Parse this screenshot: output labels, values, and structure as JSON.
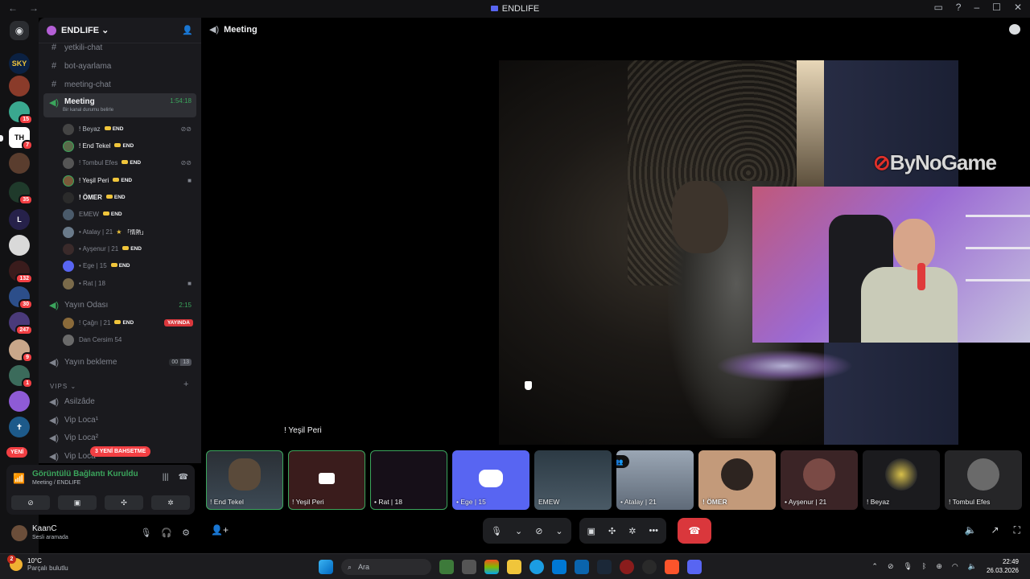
{
  "window": {
    "title": "ENDLIFE"
  },
  "server": {
    "name": "ENDLIFE"
  },
  "channels": {
    "text": [
      {
        "name": "yetkili-chat"
      },
      {
        "name": "bot-ayarlama"
      },
      {
        "name": "meeting-chat"
      }
    ],
    "meeting": {
      "name": "Meeting",
      "timer": "1:54:18",
      "status": "Bir kanal durumu belirle"
    },
    "meeting_users": [
      {
        "name": "! Beyaz",
        "tag": "END",
        "color": "#b5bac1"
      },
      {
        "name": "! End Tekel",
        "tag": "END",
        "color": "#f2f3f5"
      },
      {
        "name": "! Tombul Efes",
        "tag": "END",
        "color": "#80848e"
      },
      {
        "name": "! Yeşil Peri",
        "tag": "END",
        "color": "#f2f3f5"
      },
      {
        "name": "! ÖMER",
        "tag": "END",
        "color": "#f2f3f5"
      },
      {
        "name": "EMEW",
        "tag": "END",
        "color": "#80848e"
      },
      {
        "name": "• Atalay | 21",
        "tag": "「情熱」",
        "color": "#80848e"
      },
      {
        "name": "• Ayşenur | 21",
        "tag": "END",
        "color": "#80848e"
      },
      {
        "name": "• Ege | 15",
        "tag": "END",
        "color": "#80848e"
      },
      {
        "name": "• Rat | 18",
        "tag": "",
        "color": "#80848e"
      }
    ],
    "yayin": {
      "name": "Yayın Odası",
      "timer": "2:15"
    },
    "yayin_users": [
      {
        "name": "! Çağrı | 21",
        "tag": "END",
        "live": "YAYINDA"
      },
      {
        "name": "Dan Cersim 54"
      }
    ],
    "bekleme": {
      "name": "Yayın bekleme",
      "count_a": "00",
      "count_b": "13"
    },
    "vips_category": "VIPS",
    "vips": [
      {
        "name": "Asilzâde"
      },
      {
        "name": "Vip Loca¹"
      },
      {
        "name": "Vip Loca²"
      },
      {
        "name": "Vip Loca³"
      }
    ]
  },
  "new_badge": "YENİ",
  "mentions_badge": "3 YENİ BAHSETME",
  "rail_badges": [
    "15",
    "7",
    "35",
    "132",
    "30",
    "247",
    "9",
    "1"
  ],
  "voice_panel": {
    "status": "Görüntülü Bağlantı Kuruldu",
    "location": "Meeting / ENDLIFE"
  },
  "user": {
    "name": "KaanC",
    "status": "Sesli aramada"
  },
  "main": {
    "channel": "Meeting",
    "speaker_name": "! Yeşil Peri",
    "overlay_logo": "ByNoGame"
  },
  "tiles": [
    {
      "name": "! End Tekel",
      "speaking": true
    },
    {
      "name": "! Yeşil Peri",
      "speaking": true
    },
    {
      "name": "• Rat | 18",
      "speaking": true
    },
    {
      "name": "• Ege | 15",
      "speaking": false
    },
    {
      "name": "EMEW",
      "speaking": false
    },
    {
      "name": "• Atalay | 21",
      "speaking": false
    },
    {
      "name": "! ÖMER",
      "speaking": false
    },
    {
      "name": "• Ayşenur | 21",
      "speaking": false
    },
    {
      "name": "! Beyaz",
      "speaking": false
    },
    {
      "name": "! Tombul Efes",
      "speaking": false
    }
  ],
  "taskbar": {
    "temp": "10°C",
    "weather": "Parçalı bulutlu",
    "weather_badge": "2",
    "search_placeholder": "Ara",
    "time": "22:49",
    "date": "26.03.2026"
  },
  "colors": {
    "accent": "#5865f2",
    "online": "#3ba55c",
    "danger": "#da373c"
  }
}
